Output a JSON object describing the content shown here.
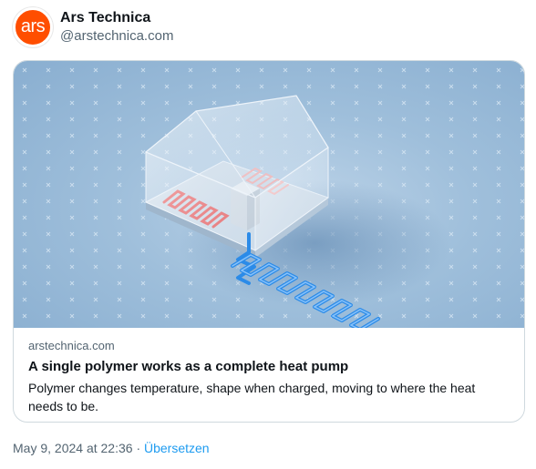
{
  "post": {
    "avatar_text": "ars",
    "display_name": "Ars Technica",
    "handle": "@arstechnica.com",
    "timestamp": "May 9, 2024 at 22:36",
    "separator": "·",
    "translate_label": "Übersetzen"
  },
  "card": {
    "domain": "arstechnica.com",
    "title": "A single polymer works as a complete heat pump",
    "description": "Polymer changes temperature, shape when charged, moving to where the heat needs to be."
  },
  "colors": {
    "brand": "#ff4e00",
    "link": "#1d9bf0",
    "secondary_text": "#536471"
  }
}
